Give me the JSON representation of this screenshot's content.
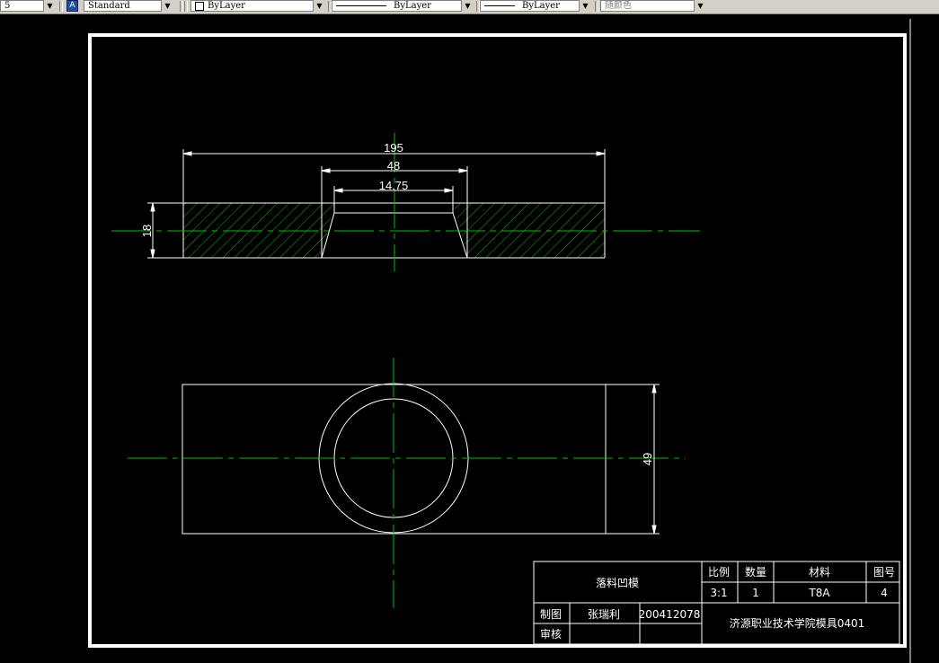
{
  "toolbar": {
    "layer_value": "5",
    "text_style": "Standard",
    "color_control": "ByLayer",
    "linetype_control": "ByLayer",
    "lineweight_control": "ByLayer",
    "plotstyle_control": "随颜色"
  },
  "drawing": {
    "dim_overall_width": "195",
    "dim_counterbore_width": "48",
    "dim_hole_width": "14.75",
    "dim_thickness": "18",
    "dim_plan_height": "49"
  },
  "title_block": {
    "part_name": "落料凹模",
    "scale_label": "比例",
    "quantity_label": "数量",
    "material_label": "材料",
    "drawing_no_label": "图号",
    "scale_value": "3:1",
    "quantity_value": "1",
    "material_value": "T8A",
    "drawing_no_value": "4",
    "drawn_label": "制图",
    "drawn_name": "张瑞利",
    "drawn_id": "200412078",
    "check_label": "审核",
    "institution": "济源职业技术学院模具0401"
  },
  "colors": {
    "background": "#000000",
    "geometry": "#ffffff",
    "centerline": "#00c000",
    "hatch": "#00c000"
  }
}
